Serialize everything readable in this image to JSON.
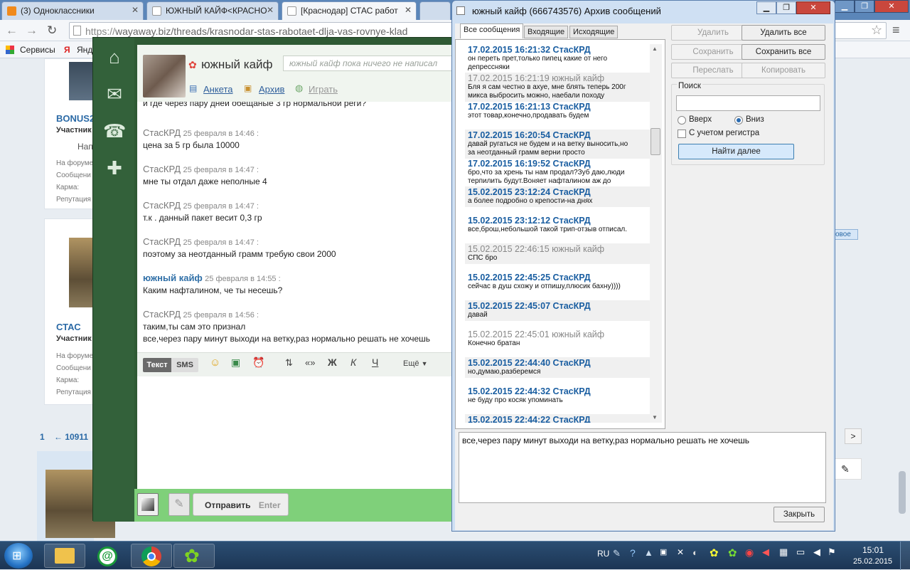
{
  "browser": {
    "tabs": [
      {
        "label": "(3) Одноклассники",
        "color": "#f08a1c"
      },
      {
        "label": "ЮЖНЫЙ КАЙФ<КРАСНО",
        "color": "#9ab0c9"
      },
      {
        "label": "[Краснодар] СТАС работ",
        "color": "#9ab0c9"
      }
    ],
    "url_scheme": "https://",
    "url_rest": "wayaway.biz/threads/krasnodar-stas-rabotaet-dlja-vas-rovnye-klad",
    "bookmarks": [
      {
        "label": "Сервисы"
      },
      {
        "label": "Янд"
      }
    ]
  },
  "forum": {
    "user1": {
      "name": "BONUS2",
      "role": "Участник",
      "btn": "Нап"
    },
    "user2": {
      "name": "СТАС",
      "role": "Участник"
    },
    "fields": [
      "На форуме",
      "Сообщени",
      "Карма:",
      "Репутация"
    ],
    "pager_first": "1",
    "pager_prev": "← 10911",
    "badge": "овое"
  },
  "icq": {
    "contact_name": "южный кайф",
    "status_placeholder": "южный кайф пока ничего не написал",
    "links": {
      "profile": "Анкета",
      "archive": "Архив",
      "play": "Играть"
    },
    "messages": [
      {
        "author": "",
        "date": "",
        "text": "и где через пару дней обещаные 3 гр нормальной реги?",
        "me": false
      },
      {
        "author": "СтасКРД",
        "date": "25 февраля в 14:46",
        "text": "цена за 5 гр была 10000",
        "me": false
      },
      {
        "author": "СтасКРД",
        "date": "25 февраля в 14:47",
        "text": "мне ты отдал даже неполные 4",
        "me": false
      },
      {
        "author": "СтасКРД",
        "date": "25 февраля в 14:47",
        "text": "т.к . данный пакет весит 0,3 гр",
        "me": false
      },
      {
        "author": "СтасКРД",
        "date": "25 февраля в 14:47",
        "text": "поэтому за неотданный грамм требую свои 2000",
        "me": false
      },
      {
        "author": "южный кайф",
        "date": "25 февраля в 14:55",
        "text": "Каким нафталином, че ты несешь?",
        "me": true
      },
      {
        "author": "СтасКРД",
        "date": "25 февраля в 14:56",
        "text": "таким,ты сам это признал",
        "text2": "все,через пару минут выходи на ветку,раз нормально решать не хочешь",
        "me": false
      }
    ],
    "compose": {
      "mode_text": "Текст",
      "mode_sms": "SMS",
      "more": "Ещё",
      "bold": "Ж",
      "italic": "К",
      "underline": "Ч",
      "quotes": "«»"
    },
    "send": {
      "label": "Отправить",
      "hint": "Enter"
    }
  },
  "archive": {
    "title": "южный кайф (666743576) Архив сообщений",
    "tabs": [
      "Все сообщения",
      "Входящие",
      "Исходящие"
    ],
    "buttons": {
      "delete": "Удалить",
      "delete_all": "Удалить все",
      "save": "Сохранить",
      "save_all": "Сохранить все",
      "forward": "Переслать",
      "copy": "Копировать",
      "find_next": "Найти далее",
      "close": "Закрыть"
    },
    "search": {
      "label": "Поиск",
      "up": "Вверх",
      "down": "Вниз",
      "case": "С учетом регистра"
    },
    "entries": [
      {
        "head": "17.02.2015 16:21:32 СтасКРД",
        "text": "он переть прет,только пипец какие от него",
        "text2": "депрессняки",
        "other": false
      },
      {
        "head": "17.02.2015 16:21:19 южный кайф",
        "text": "Бля я сам честно в ахуе, мне блять теперь 200г",
        "text2": "микса выбросить можно, наебали походу",
        "other": true
      },
      {
        "head": "17.02.2015 16:21:13 СтасКРД",
        "text": "этот товар,конечно,продавать будем",
        "text2": "",
        "other": false
      },
      {
        "head": "17.02.2015 16:20:54 СтасКРД",
        "text": "давай ругаться не будем и на ветку выносить,но",
        "text2": "за неотданный грамм верни просто",
        "other": false
      },
      {
        "head": "17.02.2015 16:19:52 СтасКРД",
        "text": "бро,что за хрень ты нам продал?Зуб даю,люди",
        "text2": "терпилить будут.Воняет нафталином аж до",
        "other": false
      },
      {
        "head": "15.02.2015 23:12:24 СтасКРД",
        "text": "а более подробно о крепости-на днях",
        "text2": "",
        "other": false
      },
      {
        "head": "15.02.2015 23:12:12 СтасКРД",
        "text": "все,брош,небольшой такой трип-отзыв отписал.",
        "text2": "",
        "other": false
      },
      {
        "head": "15.02.2015 22:46:15 южный кайф",
        "text": "СПС бро",
        "text2": "",
        "other": true
      },
      {
        "head": "15.02.2015 22:45:25 СтасКРД",
        "text": "сейчас в душ схожу и отпишу,плюсик бахну))))",
        "text2": "",
        "other": false
      },
      {
        "head": "15.02.2015 22:45:07 СтасКРД",
        "text": "давай",
        "text2": "",
        "other": false
      },
      {
        "head": "15.02.2015 22:45:01 южный кайф",
        "text": "Конечно братан",
        "text2": "",
        "other": true
      },
      {
        "head": "15.02.2015 22:44:40 СтасКРД",
        "text": "но,думаю,разберемся",
        "text2": "",
        "other": false
      },
      {
        "head": "15.02.2015 22:44:32 СтасКРД",
        "text": "не буду про косяк упоминать",
        "text2": "",
        "other": false
      },
      {
        "head": "15.02.2015 22:44:22 СтасКРД",
        "text": "",
        "text2": "",
        "other": false
      }
    ],
    "selected_text": "все,через пару минут выходи на ветку,раз нормально решать не хочешь"
  },
  "taskbar": {
    "lang": "RU",
    "time": "15:01",
    "date": "25.02.2015"
  }
}
